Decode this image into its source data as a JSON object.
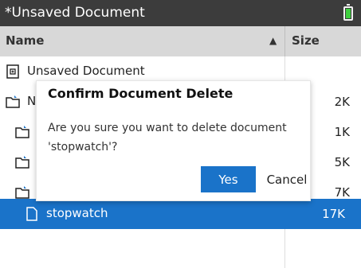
{
  "window": {
    "title": "*Unsaved Document",
    "battery_icon": "battery-full-icon",
    "battery_color": "#3fcf3f"
  },
  "columns": {
    "name": "Name",
    "size": "Size",
    "sort_indicator": "▲"
  },
  "rows": [
    {
      "icon": "document-icon",
      "label": "Unsaved Document",
      "size": ""
    },
    {
      "icon": "folder-icon",
      "label": "N",
      "size": "2K"
    },
    {
      "icon": "folder-icon",
      "label": "",
      "size": "1K"
    },
    {
      "icon": "folder-icon",
      "label": "",
      "size": "5K"
    },
    {
      "icon": "folder-icon",
      "label": "",
      "size": "7K"
    },
    {
      "icon": "file-icon",
      "label": "stopwatch",
      "size": "17K",
      "selected": true
    }
  ],
  "dialog": {
    "title": "Confirm Document Delete",
    "message": "Are you sure you want to delete document 'stopwatch'?",
    "yes_label": "Yes",
    "cancel_label": "Cancel"
  },
  "colors": {
    "titlebar": "#3c3c3c",
    "header": "#d8d8d8",
    "selection": "#1a73c9"
  }
}
